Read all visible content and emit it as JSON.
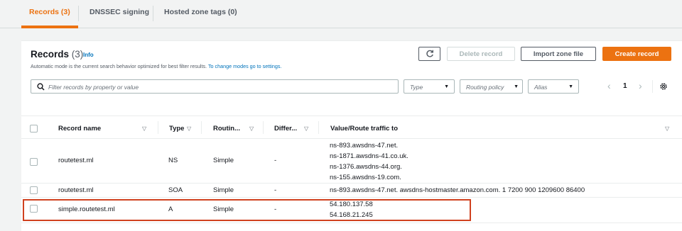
{
  "tabs": [
    {
      "label": "Records (3)"
    },
    {
      "label": "DNSSEC signing"
    },
    {
      "label": "Hosted zone tags (0)"
    }
  ],
  "header": {
    "title": "Records",
    "count": "(3)",
    "info": "Info",
    "description": "Automatic mode is the current search behavior optimized for best filter results.",
    "description_link": "To change modes go to settings."
  },
  "actions": {
    "refresh_icon": "refresh-icon",
    "delete": "Delete record",
    "import": "Import zone file",
    "create": "Create record"
  },
  "filters": {
    "search_placeholder": "Filter records by property or value",
    "type": "Type",
    "routing_policy": "Routing policy",
    "alias": "Alias"
  },
  "pagination": {
    "prev": "‹",
    "page": "1",
    "next": "›"
  },
  "table": {
    "columns": [
      "Record name",
      "Type",
      "Routin...",
      "Differ...",
      "Value/Route traffic to"
    ],
    "rows": [
      {
        "name": "routetest.ml",
        "type": "NS",
        "routing": "Simple",
        "differ": "-",
        "values": [
          "ns-893.awsdns-47.net.",
          "ns-1871.awsdns-41.co.uk.",
          "ns-1376.awsdns-44.org.",
          "ns-155.awsdns-19.com."
        ]
      },
      {
        "name": "routetest.ml",
        "type": "SOA",
        "routing": "Simple",
        "differ": "-",
        "values": [
          "ns-893.awsdns-47.net. awsdns-hostmaster.amazon.com. 1 7200 900 1209600 86400"
        ]
      },
      {
        "name": "simple.routetest.ml",
        "type": "A",
        "routing": "Simple",
        "differ": "-",
        "values": [
          "54.180.137.58",
          "54.168.21.245"
        ]
      }
    ]
  },
  "colors": {
    "accent": "#ec7211",
    "link": "#0073bb",
    "highlight": "#d0411f"
  }
}
